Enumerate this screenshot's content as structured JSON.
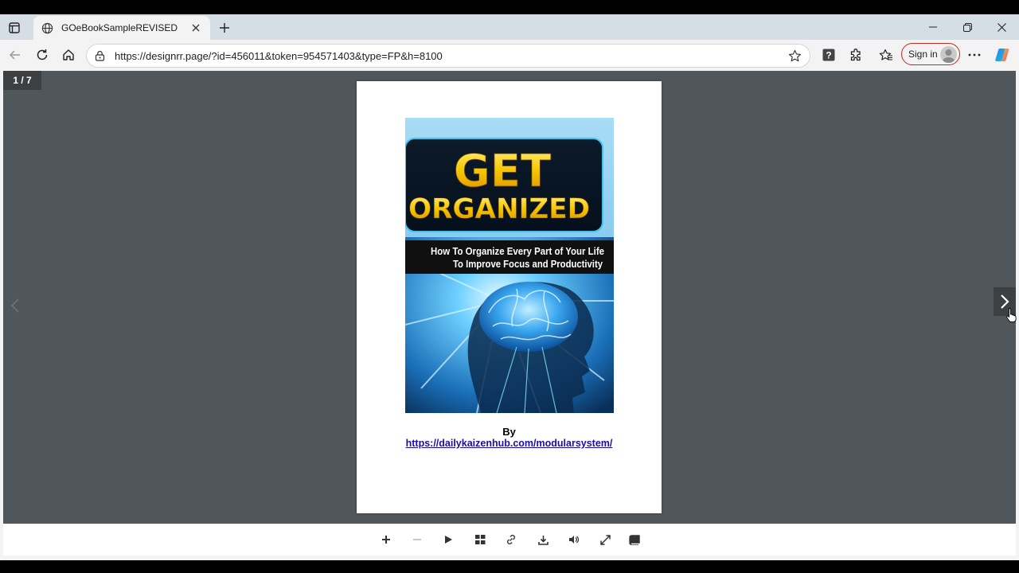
{
  "browser": {
    "tab": {
      "title": "GOeBookSampleREVISED"
    },
    "address": {
      "url": "https://designrr.page/?id=456011&token=954571403&type=FP&h=8100"
    },
    "signin_label": "Sign in"
  },
  "viewer": {
    "page_counter": "1 / 7",
    "page": {
      "by_text": "By",
      "author_link": "https://dailykaizenhub.com/modularsystem/",
      "cover": {
        "title_line1": "GET",
        "title_line2": "ORGANIZED",
        "subtitle_line1": "How To Organize Every Part of Your Life",
        "subtitle_line2": "To Improve Focus and Productivity"
      }
    }
  },
  "colors": {
    "viewer_bg": "#51565a",
    "accent_title": "#f5c400",
    "signin_border": "#c42b1c"
  },
  "icons": [
    "tab-actions-icon",
    "globe-icon",
    "close-icon",
    "plus-icon",
    "minimize-icon",
    "restore-icon",
    "back-icon",
    "refresh-icon",
    "home-icon",
    "lock-icon",
    "star-icon",
    "help-icon",
    "extensions-icon",
    "favorites-icon",
    "more-icon",
    "copilot-icon",
    "chevron-left-icon",
    "chevron-right-icon",
    "zoom-in-icon",
    "zoom-out-icon",
    "play-icon",
    "grid-icon",
    "link-icon",
    "download-icon",
    "sound-icon",
    "fullscreen-icon",
    "book-icon"
  ]
}
